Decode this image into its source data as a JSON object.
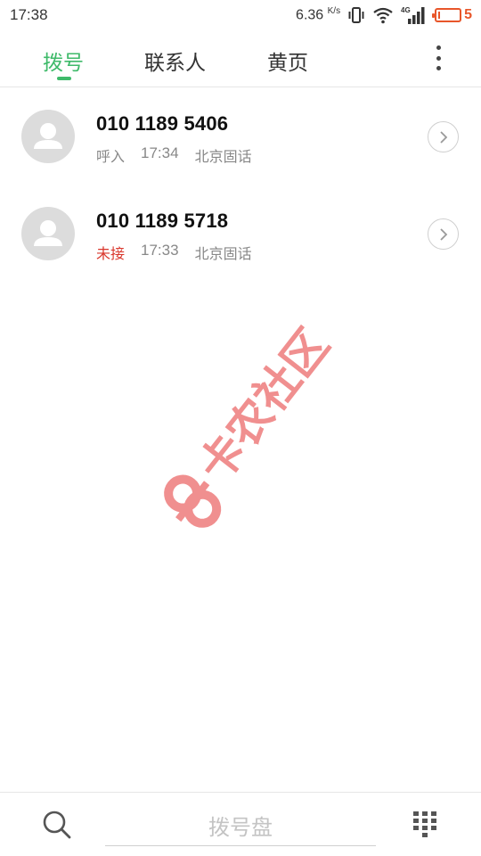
{
  "status_bar": {
    "time": "17:38",
    "net_speed_value": "6.36",
    "net_speed_unit": "K/s",
    "network_type": "4G",
    "battery_level": "5",
    "battery_fraction": 0.05
  },
  "tabs": [
    {
      "label": "拨号",
      "active": true
    },
    {
      "label": "联系人",
      "active": false
    },
    {
      "label": "黄页",
      "active": false
    }
  ],
  "calls": [
    {
      "number": "010 1189 5406",
      "type": "呼入",
      "missed": false,
      "time": "17:34",
      "location": "北京固话"
    },
    {
      "number": "010 1189 5718",
      "type": "未接",
      "missed": true,
      "time": "17:33",
      "location": "北京固话"
    }
  ],
  "watermark": {
    "text": "卡农社区"
  },
  "bottom_bar": {
    "dialpad_label": "拨号盘"
  },
  "icons": {
    "search": "search-icon",
    "keypad": "keypad-icon",
    "more": "more-vertical-icon",
    "detail": "chevron-right-icon"
  },
  "colors": {
    "accent": "#3fba6a",
    "missed": "#d9362b",
    "battery_low": "#e8562a",
    "watermark": "#f08f8f"
  }
}
